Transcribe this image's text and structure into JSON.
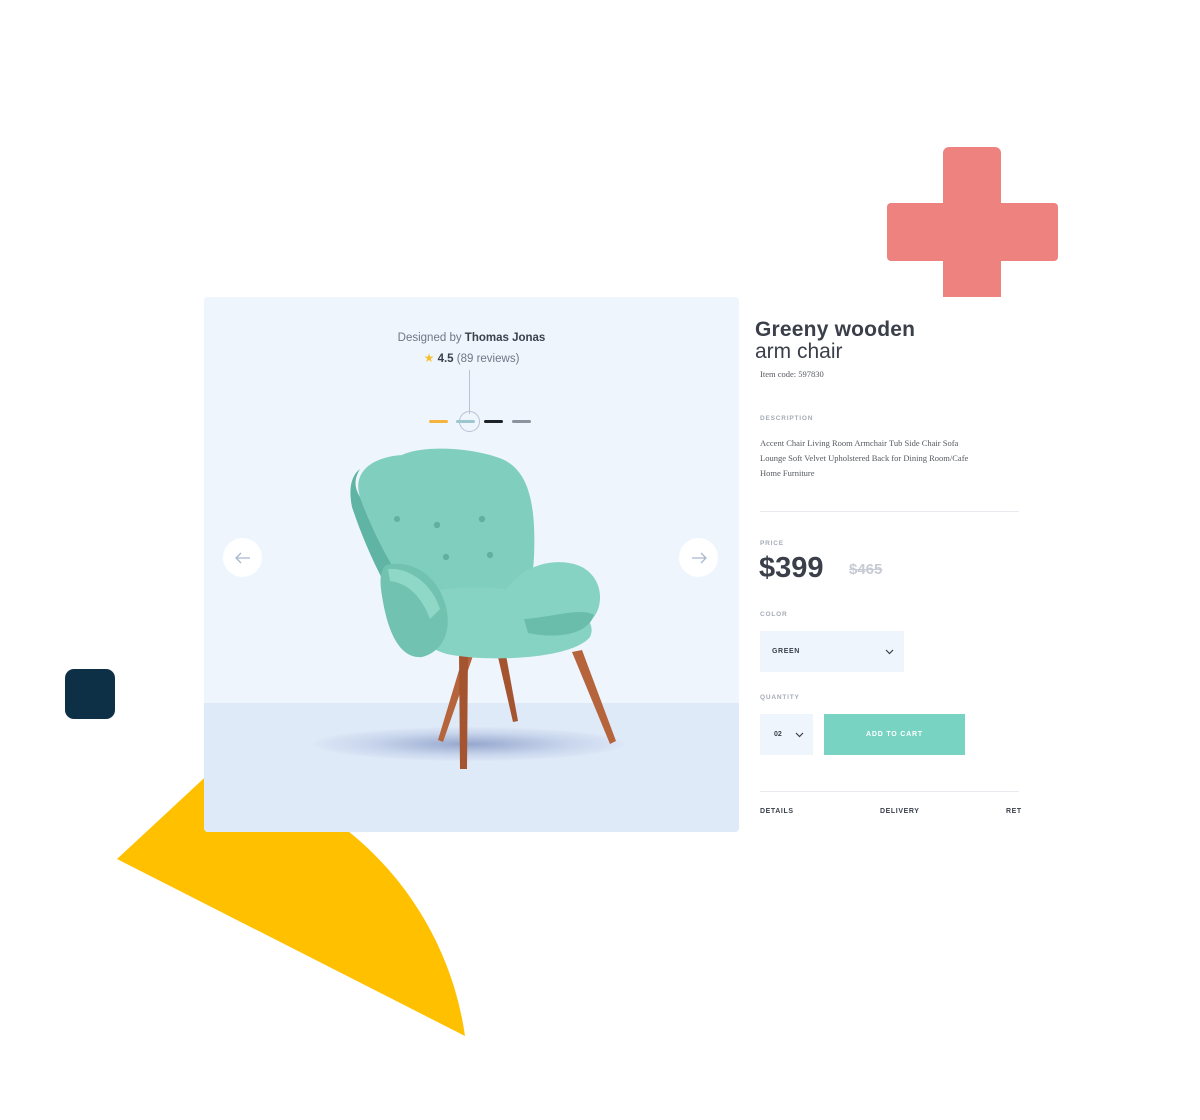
{
  "colors": {
    "accent": "#78d3c3",
    "cross": "#ed827f",
    "yellow": "#ffc000",
    "square": "#0e3047",
    "panel_bg": "#eef5fd",
    "chair": "#76c7b6"
  },
  "gallery": {
    "designer_prefix": "Designed by",
    "designer_name": "Thomas Jonas",
    "rating": "4.5",
    "reviews": "(89 reviews)",
    "swatches": [
      "#f6b43c",
      "#9cc7cf",
      "#1f2328",
      "#8d939c"
    ],
    "prev_icon": "arrow-left-icon",
    "next_icon": "arrow-right-icon"
  },
  "product": {
    "title_bold": "Greeny wooden",
    "title_light": "arm chair",
    "item_code": "Item code: 597830",
    "description_label": "DESCRIPTION",
    "description_lines": [
      "Accent Chair Living Room Armchair Tub Side Chair Sofa",
      "Lounge Soft Velvet Upholstered Back for Dining Room/Cafe",
      "Home Furniture"
    ],
    "price_label": "PRICE",
    "price": "$399",
    "old_price": "$465",
    "color_label": "COLOR",
    "color_value": "GREEN",
    "quantity_label": "QUANTITY",
    "quantity_value": "02",
    "add_to_cart": "ADD TO CART",
    "tabs": [
      "DETAILS",
      "DELIVERY",
      "RET"
    ]
  }
}
